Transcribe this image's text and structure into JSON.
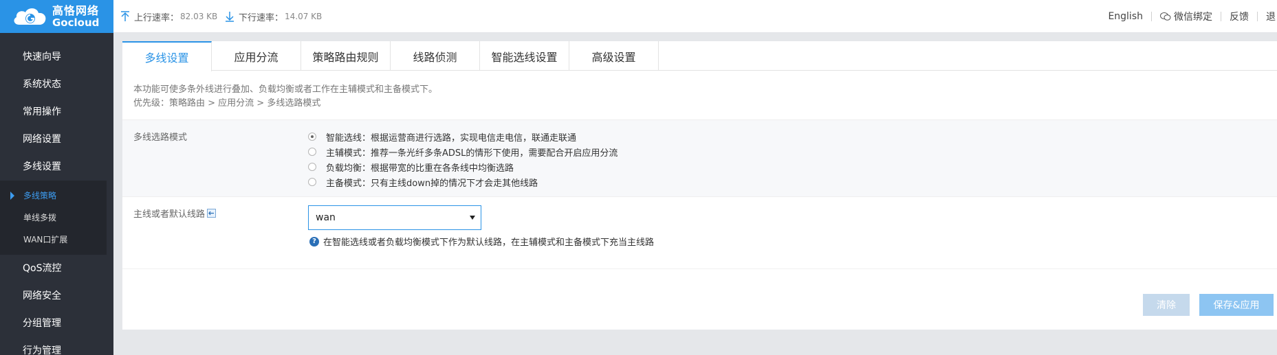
{
  "brand": {
    "name_cn": "高恪网络",
    "name_en": "Gocloud",
    "accent": "#2a93e6"
  },
  "header": {
    "upload_label": "上行速率：",
    "upload_value": "82.03 KB",
    "download_label": "下行速率：",
    "download_value": "14.07 KB",
    "links": {
      "language": "English",
      "wechat": "微信绑定",
      "feedback": "反馈",
      "logout": "退"
    }
  },
  "sidebar": {
    "items": [
      "快速向导",
      "系统状态",
      "常用操作",
      "网络设置",
      "多线设置"
    ],
    "submenu": [
      "多线策略",
      "单线多拨",
      "WAN口扩展"
    ],
    "items_after": [
      "QoS流控",
      "网络安全",
      "分组管理",
      "行为管理"
    ]
  },
  "tabs": [
    "多线设置",
    "应用分流",
    "策略路由规则",
    "线路侦测",
    "智能选线设置",
    "高级设置"
  ],
  "intro": {
    "line1": "本功能可使多条外线进行叠加、负载均衡或者工作在主辅模式和主备模式下。",
    "line2": "优先级：策略路由 > 应用分流 > 多线选路模式"
  },
  "mode": {
    "label": "多线选路模式",
    "options": [
      "智能选线：根据运营商进行选路，实现电信走电信，联通走联通",
      "主辅模式：推荐一条光纤多条ADSL的情形下使用，需要配合开启应用分流",
      "负载均衡：根据带宽的比重在各条线中均衡选路",
      "主备模式：只有主线down掉的情况下才会走其他线路"
    ],
    "selected_index": 0
  },
  "default_line": {
    "label": "主线或者默认线路",
    "value": "wan",
    "hint": "在智能选线或者负载均衡模式下作为默认线路，在主辅模式和主备模式下充当主线路"
  },
  "buttons": {
    "clear": "清除",
    "save": "保存&应用"
  }
}
